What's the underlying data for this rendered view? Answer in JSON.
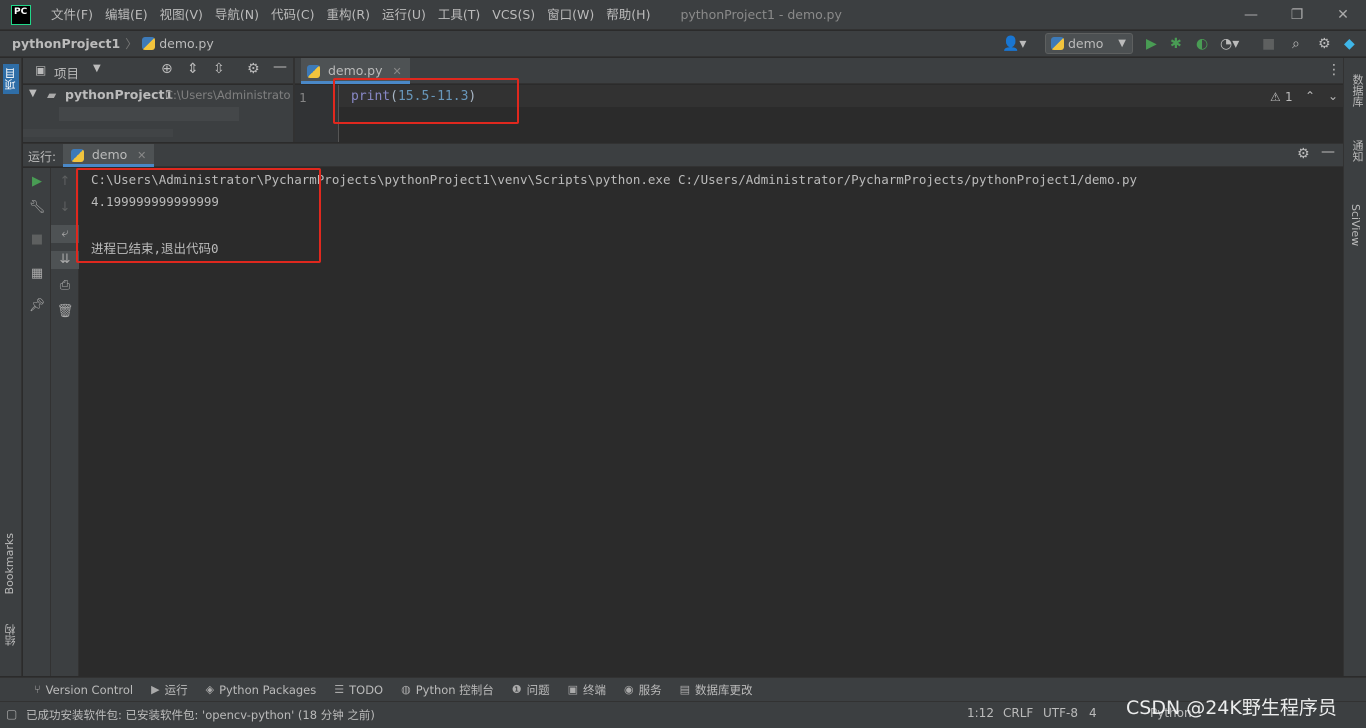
{
  "app": {
    "logo": "PC",
    "window_title": "pythonProject1 - demo.py"
  },
  "menu": [
    "文件(F)",
    "编辑(E)",
    "视图(V)",
    "导航(N)",
    "代码(C)",
    "重构(R)",
    "运行(U)",
    "工具(T)",
    "VCS(S)",
    "窗口(W)",
    "帮助(H)"
  ],
  "window_controls": {
    "minimize": "—",
    "restore": "❐",
    "close": "✕"
  },
  "breadcrumb": {
    "project": "pythonProject1",
    "separator": "〉",
    "file": "demo.py"
  },
  "toolbar": {
    "run_config": "demo"
  },
  "left_stripe": {
    "project_tab": "项目",
    "bookmarks_tab": "Bookmarks",
    "structure_tab": "结构"
  },
  "right_stripe": {
    "database_tab": "数据库",
    "notifications_tab": "通知",
    "sciview_tab": "SciView"
  },
  "project_pane": {
    "title": "项目",
    "root_name": "pythonProject1",
    "root_path": "C:\\Users\\Administrato"
  },
  "editor": {
    "tab_label": "demo.py",
    "line_number": "1",
    "code": {
      "func": "print",
      "open": "(",
      "expr": "15.5-11.3",
      "close": ")"
    },
    "inspection_warnings": "1"
  },
  "run": {
    "label": "运行:",
    "tab": "demo",
    "lines": [
      "C:\\Users\\Administrator\\PycharmProjects\\pythonProject1\\venv\\Scripts\\python.exe C:/Users/Administrator/PycharmProjects/pythonProject1/demo.py",
      "4.199999999999999",
      "",
      "进程已结束,退出代码0"
    ]
  },
  "bottom_tabs": [
    {
      "icon": "branch-icon",
      "glyph": "⑂",
      "label": "Version Control"
    },
    {
      "icon": "run-icon",
      "glyph": "▶",
      "label": "运行"
    },
    {
      "icon": "packages-icon",
      "glyph": "◈",
      "label": "Python Packages"
    },
    {
      "icon": "todo-icon",
      "glyph": "☰",
      "label": "TODO"
    },
    {
      "icon": "python-console-icon",
      "glyph": "◍",
      "label": "Python 控制台"
    },
    {
      "icon": "problems-icon",
      "glyph": "❶",
      "label": "问题"
    },
    {
      "icon": "terminal-icon",
      "glyph": "▣",
      "label": "终端"
    },
    {
      "icon": "services-icon",
      "glyph": "◉",
      "label": "服务"
    },
    {
      "icon": "db-changes-icon",
      "glyph": "▤",
      "label": "数据库更改"
    }
  ],
  "status": {
    "message": "已成功安装软件包: 已安装软件包: 'opencv-python' (18 分钟 之前)",
    "position": "1:12",
    "line_sep": "CRLF",
    "encoding": "UTF-8",
    "indent": "4",
    "interpreter": "Python"
  },
  "watermark": "CSDN @24K野生程序员",
  "colors": {
    "accent_red": "#e0281e",
    "run_green": "#499c54",
    "tab_underline": "#4a88c7"
  }
}
